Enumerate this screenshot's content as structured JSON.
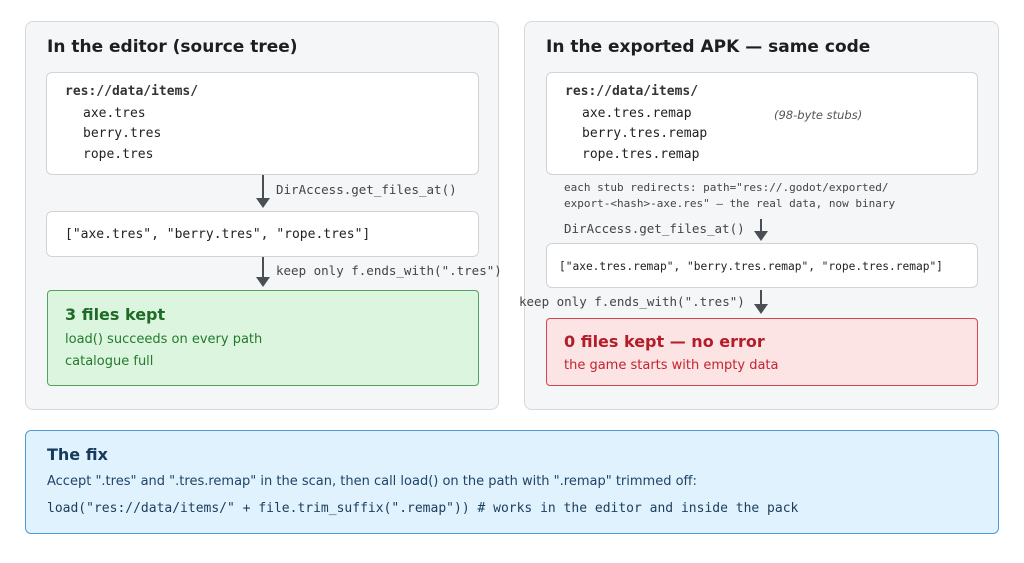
{
  "editor": {
    "title": "In the editor (source tree)",
    "folder": "res://data/items/",
    "files": [
      "axe.tres",
      "berry.tres",
      "rope.tres"
    ],
    "op1": "DirAccess.get_files_at()",
    "result": "[\"axe.tres\", \"berry.tres\", \"rope.tres\"]",
    "op2": "keep only f.ends_with(\".tres\")",
    "outcome": {
      "title": "3 files kept",
      "lines": [
        "load() succeeds on every path",
        "catalogue full"
      ]
    }
  },
  "exported": {
    "title": "In the exported APK — same code",
    "folder": "res://data/items/",
    "files": [
      "axe.tres.remap",
      "berry.tres.remap",
      "rope.tres.remap"
    ],
    "stub_note": "(98-byte stubs)",
    "redirect_note": [
      "each stub redirects: path=\"res://.godot/exported/",
      "export-<hash>-axe.res\" — the real data, now binary"
    ],
    "op1": "DirAccess.get_files_at()",
    "result": "[\"axe.tres.remap\", \"berry.tres.remap\", \"rope.tres.remap\"]",
    "op2": "keep only f.ends_with(\".tres\")",
    "outcome": {
      "title": "0 files kept — no error",
      "lines": [
        "the game starts with empty data"
      ]
    }
  },
  "fix": {
    "title": "The fix",
    "description": "Accept \".tres\" and \".tres.remap\" in the scan, then call load() on the path with \".remap\" trimmed off:",
    "code": "load(\"res://data/items/\" + file.trim_suffix(\".remap\")) # works in the editor and inside the pack"
  },
  "colors": {
    "success_bg": "#dcf5df",
    "success_border": "#52a35b",
    "error_bg": "#fce3e4",
    "error_border": "#d6454f",
    "fix_bg": "#dff2fd",
    "fix_border": "#4a9bd8"
  }
}
